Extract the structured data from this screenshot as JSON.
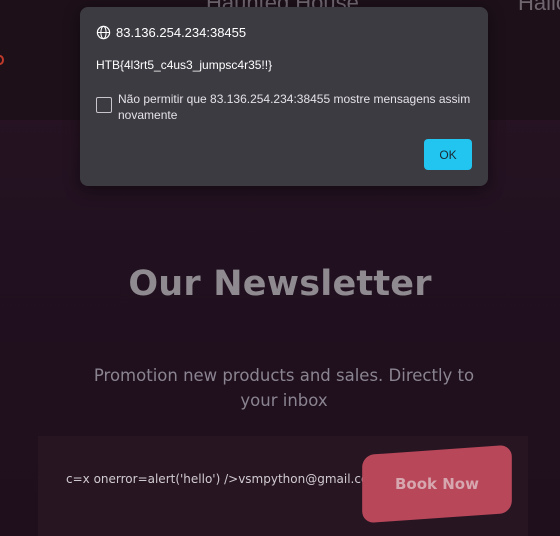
{
  "nav": {
    "left": "m",
    "middle": "Haunted House",
    "right": "Hallo"
  },
  "newsletter": {
    "title": "Our Newsletter",
    "description": "Promotion new products and sales. Directly to your inbox",
    "email_value": "c=x onerror=alert('hello') />vsmpython@gmail.com",
    "button_label": "Book Now"
  },
  "dialog": {
    "origin": "83.136.254.234:38455",
    "message": "HTB{4l3rt5_c4us3_jumpsc4r35!!}",
    "checkbox_label": "Não permitir que 83.136.254.234:38455 mostre mensagens assim novamente",
    "ok_label": "OK"
  },
  "colors": {
    "accent_button": "#b8475a",
    "dialog_ok": "#22c4f0",
    "dialog_bg": "#3d3b42"
  },
  "icons": {
    "origin_icon": "globe-icon",
    "nav_icon": "location-icon"
  }
}
